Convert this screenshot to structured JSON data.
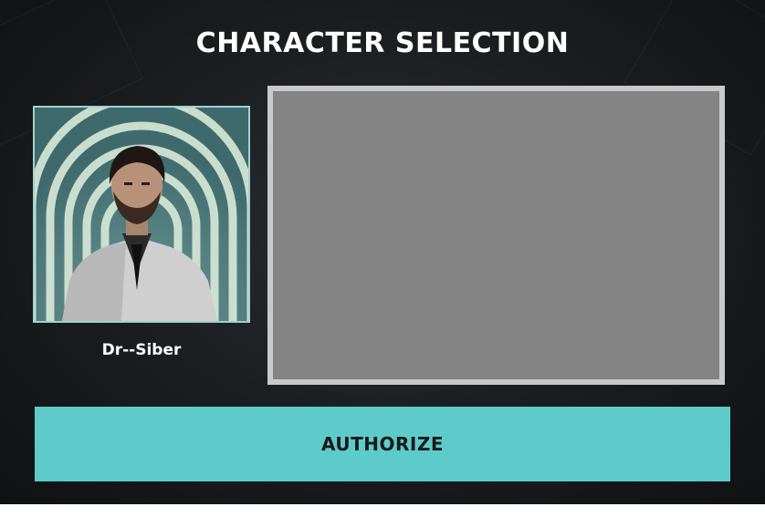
{
  "screen": {
    "title": "CHARACTER SELECTION"
  },
  "character": {
    "name": "Dr--Siber",
    "portrait_icon": "character-portrait"
  },
  "preview": {
    "background_color": "#848484",
    "frame_color": "#c9c9c9"
  },
  "actions": {
    "authorize_label": "AUTHORIZE",
    "authorize_color": "#5ecbcb"
  }
}
